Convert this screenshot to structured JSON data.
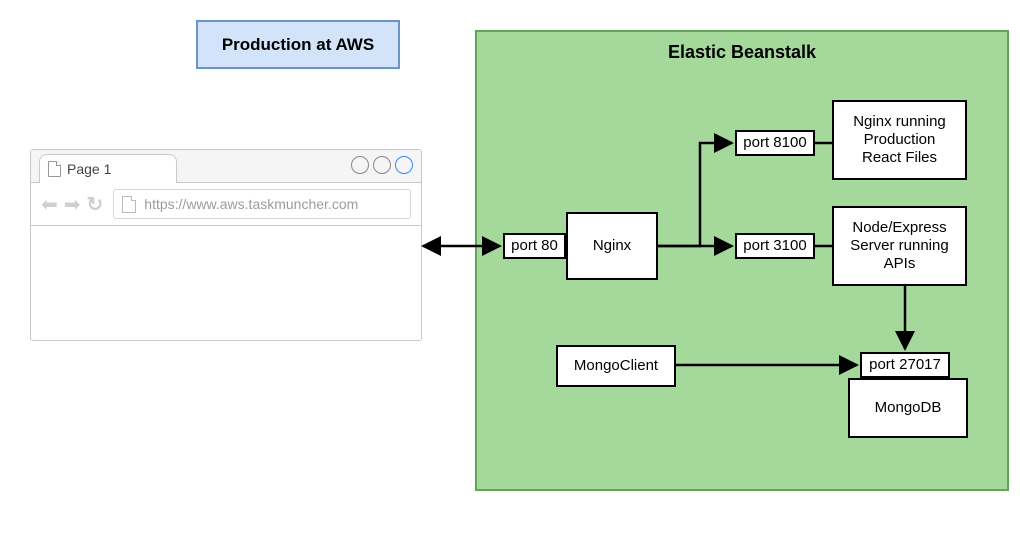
{
  "title": "Production at AWS",
  "beanstalk_title": "Elastic Beanstalk",
  "browser": {
    "tab_label": "Page 1",
    "url": "https://www.aws.taskmuncher.com"
  },
  "nodes": {
    "port80": "port 80",
    "nginx": "Nginx",
    "port8100": "port 8100",
    "port3100": "port 3100",
    "react": "Nginx running\nProduction\nReact Files",
    "node": "Node/Express\nServer running\nAPIs",
    "mongoclient": "MongoClient",
    "port27017": "port 27017",
    "mongodb": "MongoDB"
  },
  "chart_data": {
    "type": "diagram",
    "title": "Production at AWS",
    "nodes": [
      {
        "id": "browser",
        "label": "Page 1 — https://www.aws.taskmuncher.com",
        "kind": "client"
      },
      {
        "id": "beanstalk",
        "label": "Elastic Beanstalk",
        "kind": "container"
      },
      {
        "id": "port80",
        "label": "port 80",
        "parent": "beanstalk"
      },
      {
        "id": "nginx",
        "label": "Nginx",
        "parent": "beanstalk"
      },
      {
        "id": "port8100",
        "label": "port 8100",
        "parent": "beanstalk"
      },
      {
        "id": "react",
        "label": "Nginx running Production React Files",
        "parent": "beanstalk"
      },
      {
        "id": "port3100",
        "label": "port 3100",
        "parent": "beanstalk"
      },
      {
        "id": "node",
        "label": "Node/Express Server running APIs",
        "parent": "beanstalk"
      },
      {
        "id": "mongoclient",
        "label": "MongoClient",
        "parent": "beanstalk"
      },
      {
        "id": "port27017",
        "label": "port 27017",
        "parent": "beanstalk"
      },
      {
        "id": "mongodb",
        "label": "MongoDB",
        "parent": "beanstalk"
      }
    ],
    "edges": [
      {
        "from": "browser",
        "to": "port80",
        "dir": "both"
      },
      {
        "from": "port80",
        "to": "nginx",
        "dir": "none"
      },
      {
        "from": "nginx",
        "to": "port8100",
        "dir": "forward"
      },
      {
        "from": "port8100",
        "to": "react",
        "dir": "none"
      },
      {
        "from": "nginx",
        "to": "port3100",
        "dir": "forward"
      },
      {
        "from": "port3100",
        "to": "node",
        "dir": "none"
      },
      {
        "from": "node",
        "to": "port27017",
        "dir": "forward"
      },
      {
        "from": "port27017",
        "to": "mongodb",
        "dir": "none"
      },
      {
        "from": "mongoclient",
        "to": "port27017",
        "dir": "forward"
      }
    ]
  }
}
